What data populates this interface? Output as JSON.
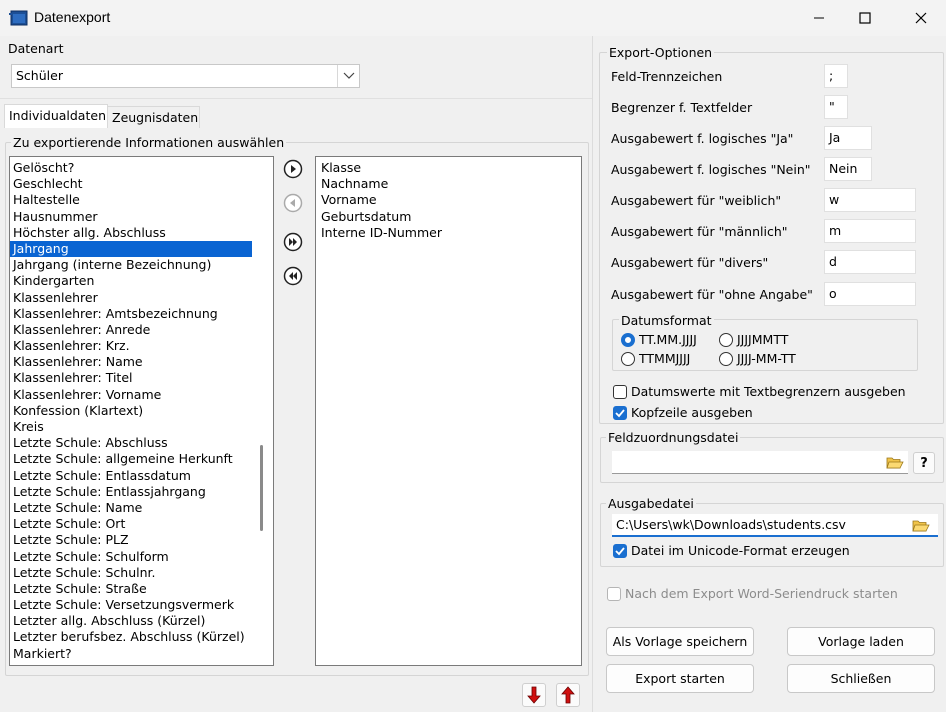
{
  "window": {
    "title": "Datenexport"
  },
  "datenart": {
    "label": "Datenart",
    "value": "Schüler"
  },
  "tabs": [
    {
      "label": "Individualdaten",
      "active": true
    },
    {
      "label": "Zeugnisdaten",
      "active": false
    }
  ],
  "select_group": {
    "label": "Zu exportierende Informationen auswählen"
  },
  "available_fields": [
    "Gelöscht?",
    "Geschlecht",
    "Haltestelle",
    "Hausnummer",
    "Höchster allg. Abschluss",
    "Jahrgang",
    "Jahrgang (interne Bezeichnung)",
    "Kindergarten",
    "Klassenlehrer",
    "Klassenlehrer: Amtsbezeichnung",
    "Klassenlehrer: Anrede",
    "Klassenlehrer: Krz.",
    "Klassenlehrer: Name",
    "Klassenlehrer: Titel",
    "Klassenlehrer: Vorname",
    "Konfession (Klartext)",
    "Kreis",
    "Letzte Schule: Abschluss",
    "Letzte Schule: allgemeine Herkunft",
    "Letzte Schule: Entlassdatum",
    "Letzte Schule: Entlassjahrgang",
    "Letzte Schule: Name",
    "Letzte Schule: Ort",
    "Letzte Schule: PLZ",
    "Letzte Schule: Schulform",
    "Letzte Schule: Schulnr.",
    "Letzte Schule: Straße",
    "Letzte Schule: Versetzungsvermerk",
    "Letzter allg. Abschluss (Kürzel)",
    "Letzter berufsbez. Abschluss (Kürzel)",
    "Markiert?"
  ],
  "selected_available": "Jahrgang",
  "chosen_fields": [
    "Klasse",
    "Nachname",
    "Vorname",
    "Geburtsdatum",
    "Interne ID-Nummer"
  ],
  "export_options": {
    "label": "Export-Optionen",
    "rows": [
      {
        "label": "Feld-Trennzeichen",
        "value": ";"
      },
      {
        "label": "Begrenzer f. Textfelder",
        "value": "\""
      },
      {
        "label": "Ausgabewert f. logisches \"Ja\"",
        "value": "Ja"
      },
      {
        "label": "Ausgabewert f. logisches \"Nein\"",
        "value": "Nein"
      },
      {
        "label": "Ausgabewert für \"weiblich\"",
        "value": "w"
      },
      {
        "label": "Ausgabewert für \"männlich\"",
        "value": "m"
      },
      {
        "label": "Ausgabewert für \"divers\"",
        "value": "d"
      },
      {
        "label": "Ausgabewert für \"ohne Angabe\"",
        "value": "o"
      }
    ],
    "datumsformat": {
      "label": "Datumsformat",
      "options": [
        "TT.MM.JJJJ",
        "JJJJMMTT",
        "TTMMJJJJ",
        "JJJJ-MM-TT"
      ],
      "selected": "TT.MM.JJJJ"
    },
    "checkboxes": [
      {
        "label": "Datumswerte mit Textbegrenzern ausgeben",
        "checked": false
      },
      {
        "label": "Kopfzeile ausgeben",
        "checked": true
      }
    ]
  },
  "feldzuordnung": {
    "label": "Feldzuordnungsdatei",
    "value": "",
    "help": "?"
  },
  "ausgabe": {
    "label": "Ausgabedatei",
    "value": "C:\\Users\\wk\\Downloads\\students.csv",
    "unicode_label": "Datei im Unicode-Format erzeugen",
    "unicode_checked": true
  },
  "seriendruck": {
    "label": "Nach dem Export Word-Seriendruck starten",
    "checked": false
  },
  "buttons": {
    "save_template": "Als Vorlage speichern",
    "load_template": "Vorlage laden",
    "start_export": "Export starten",
    "close": "Schließen"
  },
  "colors": {
    "selection": "#0a64d2",
    "accent": "#1a6fd0",
    "arrow_red": "#d01010"
  }
}
